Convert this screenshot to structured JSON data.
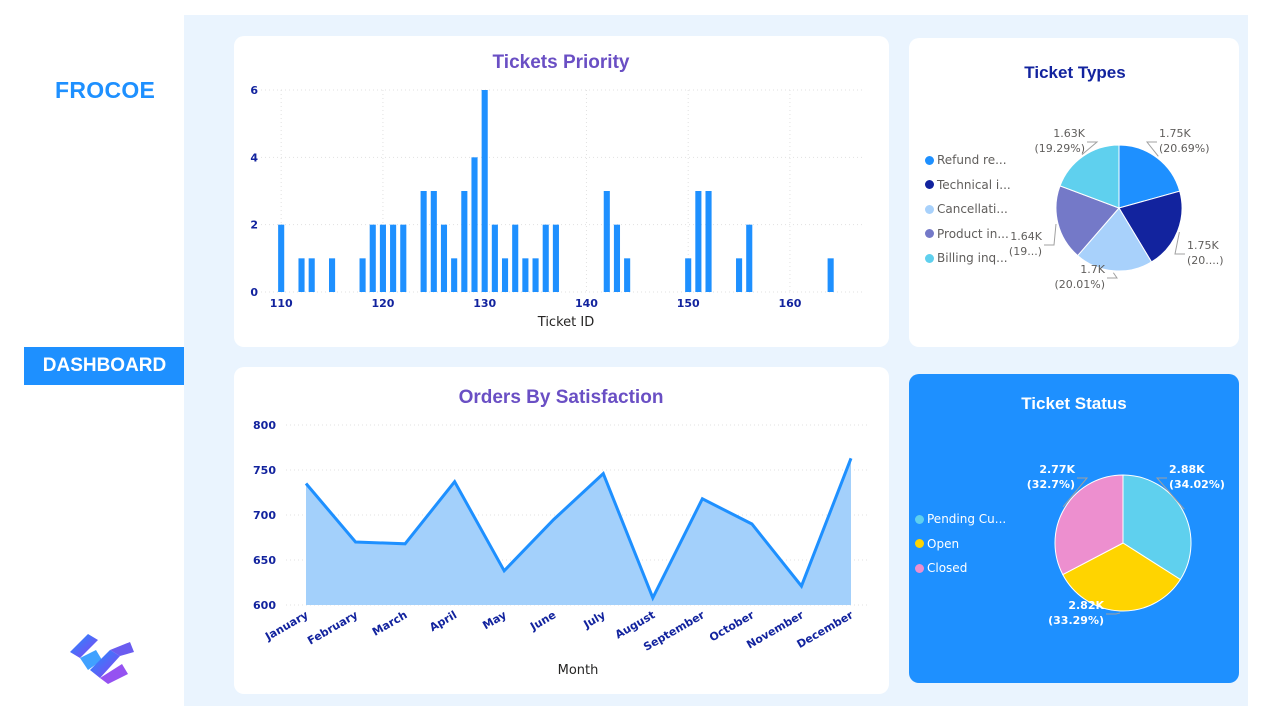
{
  "brand": {
    "name": "FROCOE"
  },
  "nav": {
    "dashboard_label": "DASHBOARD"
  },
  "charts": {
    "priority": {
      "title": "Tickets Priority",
      "xlabel": "Ticket ID",
      "x_ticks": [
        "110",
        "120",
        "130",
        "140",
        "150",
        "160"
      ],
      "y_ticks": [
        "0",
        "2",
        "4",
        "6"
      ],
      "color": "#1e90ff"
    },
    "types": {
      "title": "Ticket Types",
      "legend": [
        "Refund re...",
        "Technical i...",
        "Cancellati...",
        "Product in...",
        "Billing inq..."
      ],
      "labels": [
        {
          "value": "1.75K",
          "pct": "(20.69%)"
        },
        {
          "value": "1.75K",
          "pct": "(20....)"
        },
        {
          "value": "1.7K",
          "pct": "(20.01%)"
        },
        {
          "value": "1.64K",
          "pct": "(19...)"
        },
        {
          "value": "1.63K",
          "pct": "(19.29%)"
        }
      ],
      "colors": [
        "#1e90ff",
        "#12239e",
        "#a8d1fb",
        "#7479c8",
        "#5fd0ee"
      ]
    },
    "satisfaction": {
      "title": "Orders By Satisfaction",
      "xlabel": "Month",
      "y_ticks": [
        "600",
        "650",
        "700",
        "750",
        "800"
      ],
      "months": [
        "January",
        "February",
        "March",
        "April",
        "May",
        "June",
        "July",
        "August",
        "September",
        "October",
        "November",
        "December"
      ],
      "line_color": "#1e90ff",
      "fill_color": "#a3d0fb"
    },
    "status": {
      "title": "Ticket Status",
      "legend": [
        "Pending Cu...",
        "Open",
        "Closed"
      ],
      "labels": [
        {
          "value": "2.88K",
          "pct": "(34.02%)"
        },
        {
          "value": "2.82K",
          "pct": "(33.29%)"
        },
        {
          "value": "2.77K",
          "pct": "(32.7%)"
        }
      ],
      "colors": [
        "#5fd0ee",
        "#ffd400",
        "#ed8fcf"
      ]
    }
  },
  "chart_data": [
    {
      "type": "bar",
      "x": [
        110,
        112,
        113,
        115,
        118,
        119,
        120,
        121,
        122,
        124,
        125,
        126,
        127,
        128,
        129,
        130,
        131,
        132,
        133,
        134,
        135,
        136,
        137,
        142,
        143,
        144,
        150,
        151,
        152,
        155,
        156,
        164
      ],
      "values": [
        2,
        1,
        1,
        1,
        1,
        2,
        2,
        2,
        2,
        3,
        3,
        2,
        1,
        3,
        4,
        6,
        2,
        1,
        2,
        1,
        1,
        2,
        2,
        3,
        2,
        1,
        1,
        3,
        3,
        1,
        2,
        1
      ],
      "title": "Tickets Priority",
      "xlabel": "Ticket ID",
      "ylabel": "",
      "xlim": [
        109,
        166
      ],
      "ylim": [
        0,
        6
      ]
    },
    {
      "type": "pie",
      "categories": [
        "Refund re...",
        "Technical i...",
        "Cancellati...",
        "Product in...",
        "Billing inq..."
      ],
      "values": [
        20.69,
        20.68,
        20.01,
        19.33,
        19.29
      ],
      "title": "Ticket Types"
    },
    {
      "type": "area",
      "categories": [
        "January",
        "February",
        "March",
        "April",
        "May",
        "June",
        "July",
        "August",
        "September",
        "October",
        "November",
        "December"
      ],
      "values": [
        735,
        670,
        668,
        737,
        638,
        695,
        746,
        608,
        718,
        690,
        621,
        763
      ],
      "title": "Orders By Satisfaction",
      "xlabel": "Month",
      "ylabel": "",
      "ylim": [
        600,
        800
      ]
    },
    {
      "type": "pie",
      "categories": [
        "Pending Cu...",
        "Open",
        "Closed"
      ],
      "values": [
        34.02,
        33.29,
        32.7
      ],
      "title": "Ticket Status"
    }
  ]
}
